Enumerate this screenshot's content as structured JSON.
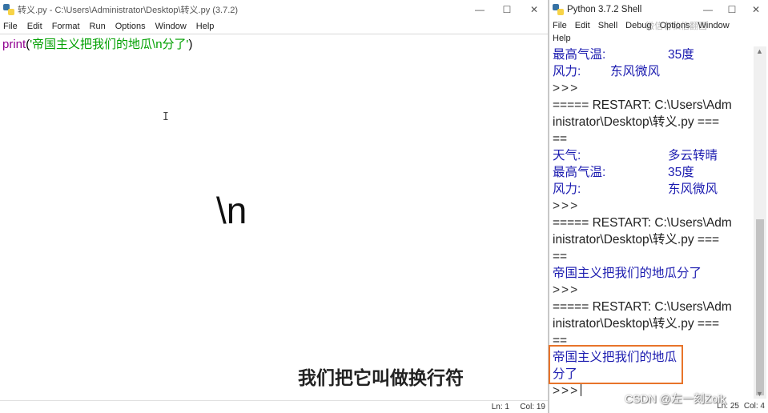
{
  "editor": {
    "title": "转义.py - C:\\Users\\Administrator\\Desktop\\转义.py (3.7.2)",
    "controls": {
      "minimize": "—",
      "maximize": "☐",
      "close": "✕"
    },
    "menu": [
      "File",
      "Edit",
      "Format",
      "Run",
      "Options",
      "Window",
      "Help"
    ],
    "code": {
      "func": "print",
      "open": "(",
      "string": "'帝国主义把我们的地瓜\\n分了'",
      "close": ")"
    },
    "cursor_glyph": "I",
    "overlay_big_text": "\\n",
    "subtitle": "我们把它叫做换行符",
    "status": {
      "ln": "Ln: 1",
      "col": "Col: 19"
    }
  },
  "shell": {
    "title": "Python 3.7.2 Shell",
    "controls": {
      "minimize": "—",
      "maximize": "☐",
      "close": "✕"
    },
    "menu_row1": [
      "File",
      "Edit",
      "Shell",
      "Debug",
      "Options",
      "Window"
    ],
    "menu_row2": [
      "Help"
    ],
    "watermark_overlay": "微信有私信翻画",
    "output": [
      {
        "type": "kv",
        "label": "最高气温:",
        "value": "35度",
        "color": "blue"
      },
      {
        "type": "kv-short",
        "label": "风力:",
        "value": "东风微风",
        "color": "blue"
      },
      {
        "type": "prompt",
        "text": ">>>"
      },
      {
        "type": "text",
        "text": "===== RESTART: C:\\Users\\Adm",
        "color": "dark"
      },
      {
        "type": "text",
        "text": "inistrator\\Desktop\\转义.py ===",
        "color": "dark"
      },
      {
        "type": "text",
        "text": "==",
        "color": "dark"
      },
      {
        "type": "kv",
        "label": "天气:",
        "value": "多云转晴",
        "color": "blue"
      },
      {
        "type": "kv",
        "label": "最高气温:",
        "value": "35度",
        "color": "blue"
      },
      {
        "type": "kv",
        "label": "风力:",
        "value": "东风微风",
        "color": "blue"
      },
      {
        "type": "prompt",
        "text": ">>>"
      },
      {
        "type": "text",
        "text": "===== RESTART: C:\\Users\\Adm",
        "color": "dark"
      },
      {
        "type": "text",
        "text": "inistrator\\Desktop\\转义.py ===",
        "color": "dark"
      },
      {
        "type": "text",
        "text": "==",
        "color": "dark"
      },
      {
        "type": "text",
        "text": "帝国主义把我们的地瓜分了",
        "color": "blue"
      },
      {
        "type": "prompt",
        "text": ">>>"
      },
      {
        "type": "text",
        "text": "===== RESTART: C:\\Users\\Adm",
        "color": "dark"
      },
      {
        "type": "text",
        "text": "inistrator\\Desktop\\转义.py ===",
        "color": "dark"
      },
      {
        "type": "text",
        "text": "==",
        "color": "dark"
      },
      {
        "type": "text",
        "text": "帝国主义把我们的地瓜",
        "color": "blue"
      },
      {
        "type": "text",
        "text": "分了",
        "color": "blue"
      },
      {
        "type": "prompt-caret",
        "text": ">>>"
      }
    ],
    "status": {
      "ln": "Ln: 25",
      "col": "Col: 4"
    }
  },
  "watermark": "CSDN @左一刻Zoik",
  "colors": {
    "highlight_box": "#e8742a",
    "output_blue": "#1c1cb0",
    "string_green": "#00a000",
    "builtin_purple": "#900090"
  }
}
